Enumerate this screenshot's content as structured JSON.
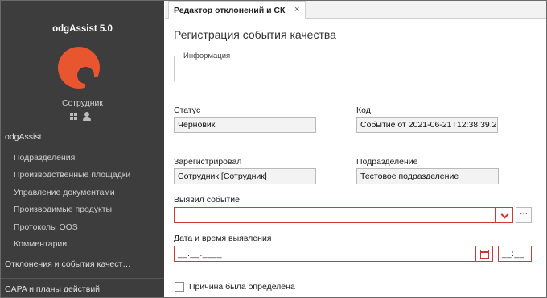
{
  "sidebar": {
    "app_title": "odgAssist 5.0",
    "role": "Сотрудник",
    "role_icons": [
      "grid-icon",
      "user-icon"
    ],
    "section_title": "odgAssist",
    "items": [
      {
        "label": "Подразделения"
      },
      {
        "label": "Производственные площадки"
      },
      {
        "label": "Управление документами"
      },
      {
        "label": "Производимые продукты"
      },
      {
        "label": "Протоколы OOS"
      },
      {
        "label": "Комментарии"
      }
    ],
    "section_deviations": "Отклонения и события качест…",
    "section_capa": "CAPA и планы действий"
  },
  "tab": {
    "label": "Редактор отклонений и СК",
    "close": "×"
  },
  "form": {
    "title": "Регистрация события качества",
    "info_legend": "Информация",
    "status_label": "Статус",
    "status_value": "Черновик",
    "code_label": "Код",
    "code_value": "Событие от 2021-06-21T12:38:39.2",
    "registered_label": "Зарегистрировал",
    "registered_value": "Сотрудник [Сотрудник]",
    "department_label": "Подразделение",
    "department_value": "Тестовое подразделение",
    "detected_label": "Выявил событие",
    "detected_value": "",
    "more_button": "···",
    "datetime_label": "Дата и время выявления",
    "date_mask": "__.__.____",
    "time_mask": "__:__",
    "reason_label": "Причина была определена",
    "reason_checked": false
  },
  "colors": {
    "sidebar_bg": "#3d3d3d",
    "logo": "#e8552e",
    "required_border": "#cc3a3a"
  }
}
